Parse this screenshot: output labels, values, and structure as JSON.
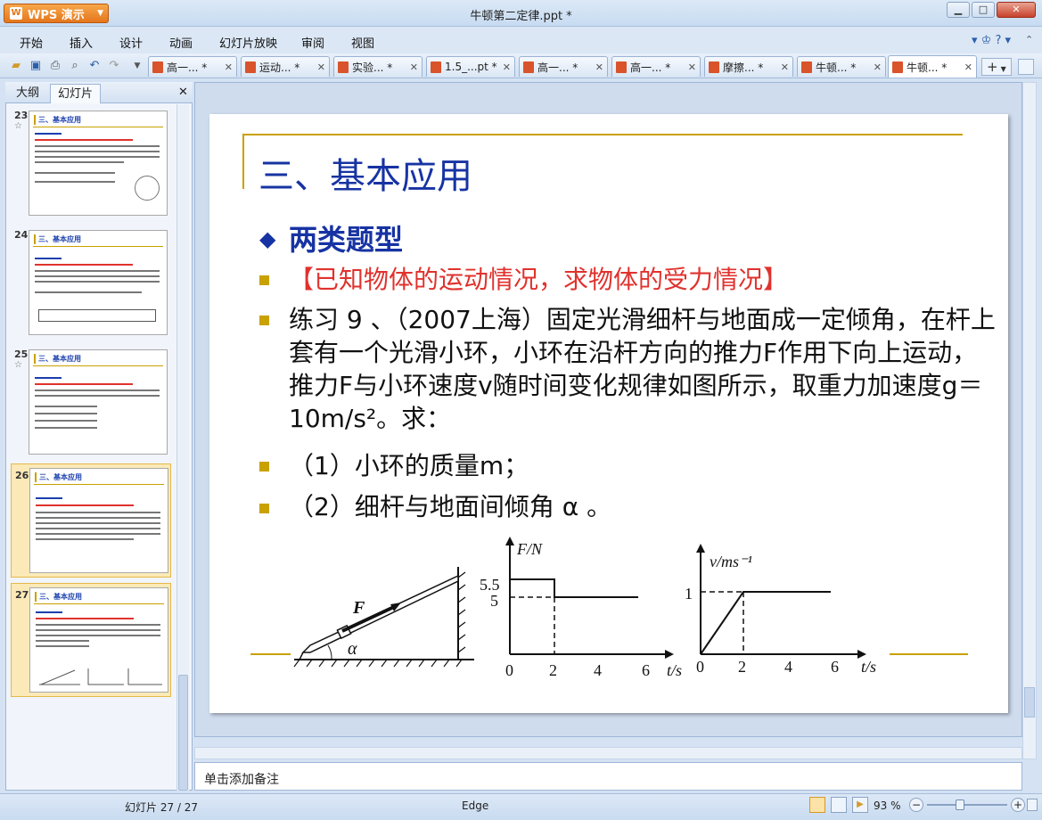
{
  "app": {
    "name": "WPS 演示",
    "window_title": "牛顿第二定律.ppt *"
  },
  "window_controls": {
    "minimize": "▁",
    "maximize": "□",
    "close": "✕"
  },
  "menu": [
    "开始",
    "插入",
    "设计",
    "动画",
    "幻灯片放映",
    "审阅",
    "视图"
  ],
  "doc_tabs": [
    {
      "label": "高一... *",
      "active": false
    },
    {
      "label": "运动... *",
      "active": false
    },
    {
      "label": "实验... *",
      "active": false
    },
    {
      "label": "1.5_...pt *",
      "active": false
    },
    {
      "label": "高一... *",
      "active": false
    },
    {
      "label": "高一... *",
      "active": false
    },
    {
      "label": "摩擦... *",
      "active": false
    },
    {
      "label": "牛顿... *",
      "active": false
    },
    {
      "label": "牛顿... *",
      "active": true
    }
  ],
  "panel": {
    "tab_outline": "大纲",
    "tab_slides": "幻灯片",
    "close": "✕"
  },
  "thumbnails": [
    {
      "num": "23",
      "title": "三、基本应用",
      "selected": false
    },
    {
      "num": "24",
      "title": "三、基本应用",
      "selected": false
    },
    {
      "num": "25",
      "title": "三、基本应用",
      "selected": false
    },
    {
      "num": "26",
      "title": "三、基本应用",
      "selected": true
    },
    {
      "num": "27",
      "title": "三、基本应用",
      "selected": true
    }
  ],
  "slide": {
    "title": "三、基本应用",
    "subtitle": "两类题型",
    "bullets": [
      "【已知物体的运动情况，求物体的受力情况】",
      "练习 9 、（2007上海）固定光滑细杆与地面成一定倾角，在杆上套有一个光滑小环，小环在沿杆方向的推力F作用下向上运动，推力F与小环速度v随时间变化规律如图所示，取重力加速度g＝10m/s²。求：",
      "（1）小环的质量m；",
      "（2）细杆与地面间倾角 α 。"
    ],
    "diagram": {
      "force_label": "F",
      "angle_label": "α",
      "graph1": {
        "ylabel": "F/N",
        "xlabel": "t/s",
        "yticks": [
          "5.5",
          "5"
        ],
        "xticks": [
          "0",
          "2",
          "4",
          "6"
        ]
      },
      "graph2": {
        "ylabel": "v/ms⁻¹",
        "xlabel": "t/s",
        "yticks": [
          "1"
        ],
        "xticks": [
          "0",
          "2",
          "4",
          "6"
        ]
      }
    }
  },
  "notes_placeholder": "单击添加备注",
  "status": {
    "slide_counter": "幻灯片 27 / 27",
    "theme": "Edge",
    "zoom": "93 %"
  }
}
